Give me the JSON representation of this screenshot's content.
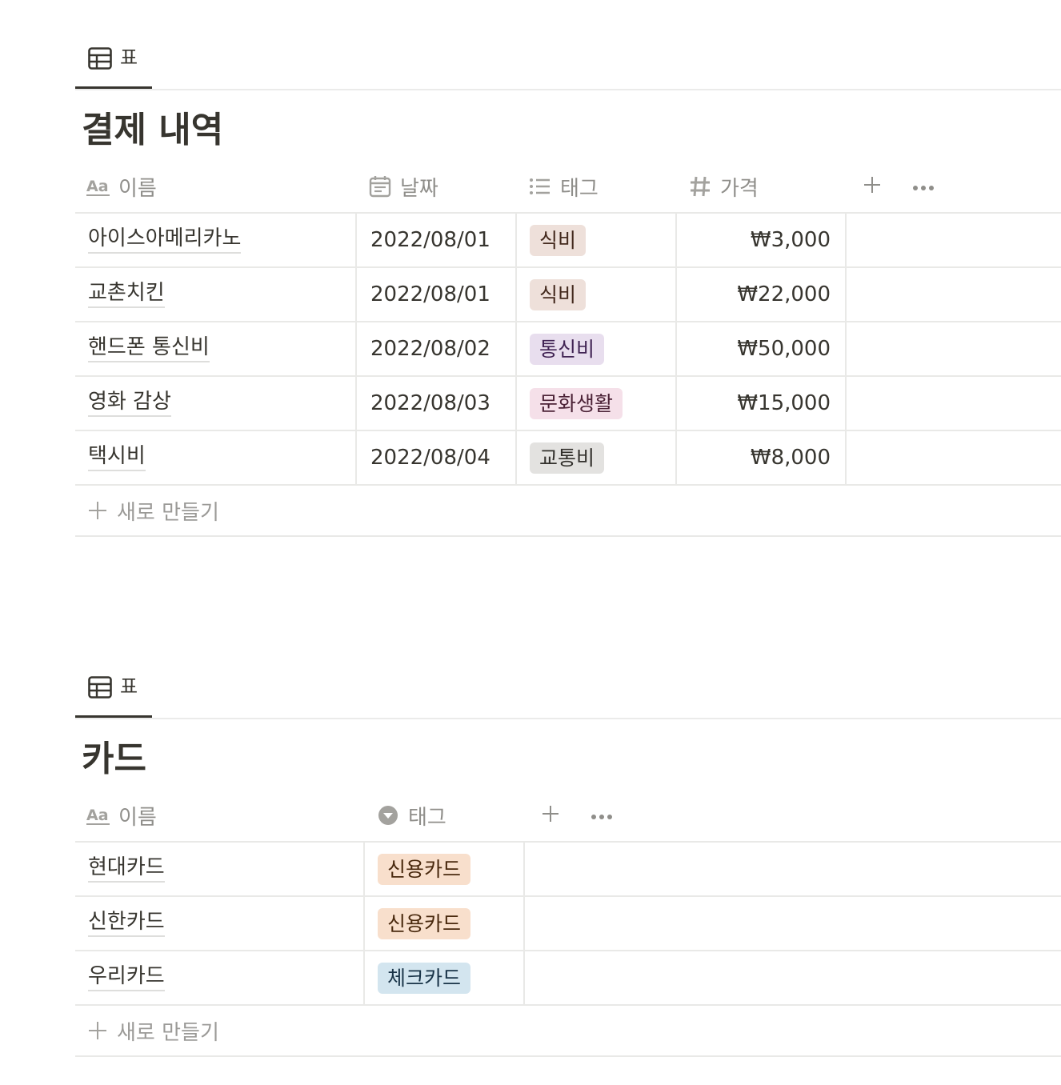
{
  "colors": {
    "text": "#37352f",
    "muted": "#8f8e8a",
    "border": "#e9e9e7",
    "tag_food_bg": "#eee0da",
    "tag_telecom_bg": "#e8deee",
    "tag_culture_bg": "#f5e0e9",
    "tag_transport_bg": "#e3e2e0",
    "tag_credit_bg": "#f8dfcc",
    "tag_check_bg": "#d3e5ef"
  },
  "payments": {
    "view_tab": {
      "icon": "table-icon",
      "label": "표"
    },
    "title": "결제 내역",
    "columns": {
      "name": {
        "icon": "text-aa-icon",
        "label": "이름"
      },
      "date": {
        "icon": "calendar-icon",
        "label": "날짜"
      },
      "tag": {
        "icon": "list-icon",
        "label": "태그"
      },
      "price": {
        "icon": "number-hash-icon",
        "label": "가격"
      }
    },
    "rows": [
      {
        "name": "아이스아메리카노",
        "date": "2022/08/01",
        "tag": "식비",
        "tag_color": "#eee0da",
        "tag_text": "#442a1e",
        "price": "₩3,000"
      },
      {
        "name": "교촌치킨",
        "date": "2022/08/01",
        "tag": "식비",
        "tag_color": "#eee0da",
        "tag_text": "#442a1e",
        "price": "₩22,000"
      },
      {
        "name": "핸드폰 통신비",
        "date": "2022/08/02",
        "tag": "통신비",
        "tag_color": "#e8deee",
        "tag_text": "#412454",
        "price": "₩50,000"
      },
      {
        "name": "영화 감상",
        "date": "2022/08/03",
        "tag": "문화생활",
        "tag_color": "#f5e0e9",
        "tag_text": "#4c2337",
        "price": "₩15,000"
      },
      {
        "name": "택시비",
        "date": "2022/08/04",
        "tag": "교통비",
        "tag_color": "#e3e2e0",
        "tag_text": "#32302c",
        "price": "₩8,000"
      }
    ],
    "new_label": "새로 만들기"
  },
  "cards": {
    "view_tab": {
      "icon": "table-icon",
      "label": "표"
    },
    "title": "카드",
    "columns": {
      "name": {
        "icon": "text-aa-icon",
        "label": "이름"
      },
      "tag": {
        "icon": "select-chevron-circle-icon",
        "label": "태그"
      }
    },
    "rows": [
      {
        "name": "현대카드",
        "tag": "신용카드",
        "tag_color": "#f8dfcc",
        "tag_text": "#49290e"
      },
      {
        "name": "신한카드",
        "tag": "신용카드",
        "tag_color": "#f8dfcc",
        "tag_text": "#49290e"
      },
      {
        "name": "우리카드",
        "tag": "체크카드",
        "tag_color": "#d3e5ef",
        "tag_text": "#183347"
      }
    ],
    "new_label": "새로 만들기"
  }
}
